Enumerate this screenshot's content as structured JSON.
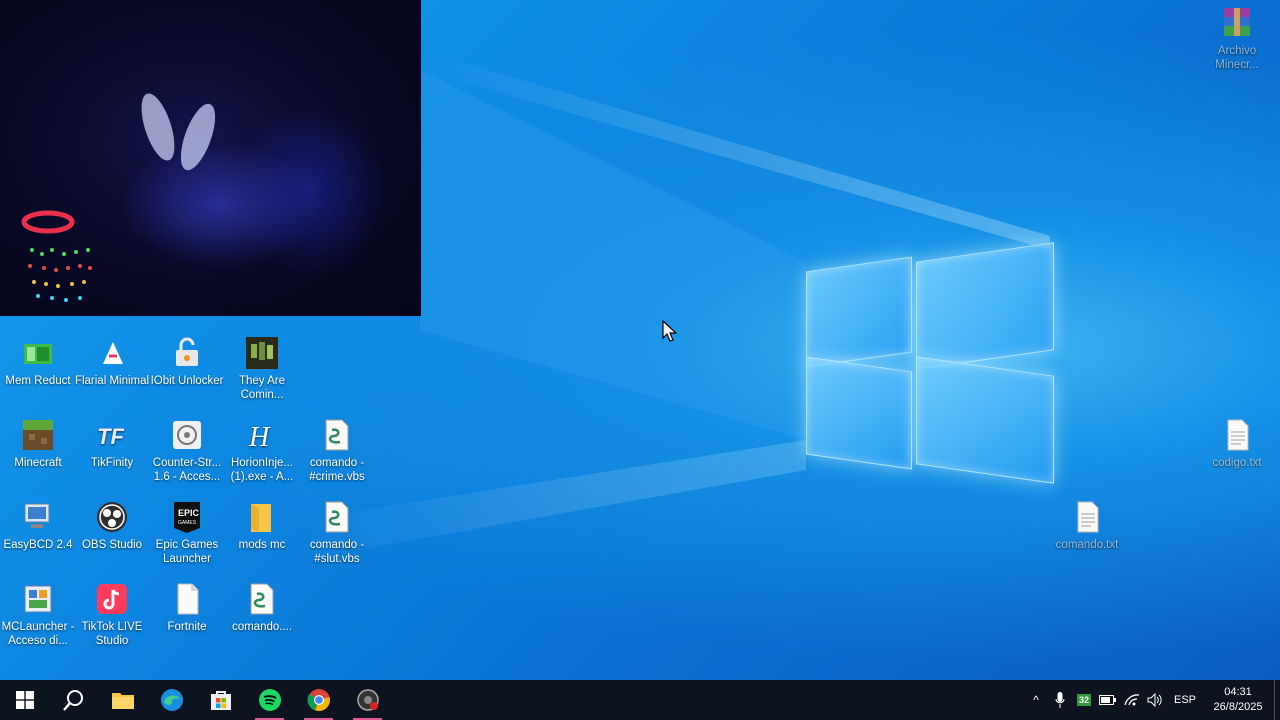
{
  "desktop": {
    "icons_left": [
      {
        "label": "Mem Reduct",
        "icon": "mem-reduct-icon"
      },
      {
        "label": "Flarial Minimal",
        "icon": "flarial-icon"
      },
      {
        "label": "IObit Unlocker",
        "icon": "iobit-unlocker-icon"
      },
      {
        "label": "They Are Comin...",
        "icon": "they-are-coming-icon"
      },
      {
        "label": "Minecraft",
        "icon": "minecraft-icon"
      },
      {
        "label": "TikFinity",
        "icon": "tikfinity-icon"
      },
      {
        "label": "Counter-Str... 1.6 - Acces...",
        "icon": "counter-strike-icon"
      },
      {
        "label": "HorionInje... (1).exe - A...",
        "icon": "horion-icon"
      },
      {
        "label": "comando - #crime.vbs",
        "icon": "vbs-script-icon"
      },
      {
        "label": "EasyBCD 2.4",
        "icon": "easybcd-icon"
      },
      {
        "label": "OBS Studio",
        "icon": "obs-icon"
      },
      {
        "label": "Epic Games Launcher",
        "icon": "epic-games-icon"
      },
      {
        "label": "mods mc",
        "icon": "folder-icon"
      },
      {
        "label": "comando - #slut.vbs",
        "icon": "vbs-script-icon"
      },
      {
        "label": "MCLauncher - Acceso di...",
        "icon": "mclauncher-icon"
      },
      {
        "label": "TikTok LIVE Studio",
        "icon": "tiktok-live-icon"
      },
      {
        "label": "Fortnite",
        "icon": "file-icon"
      },
      {
        "label": "comando....",
        "icon": "vbs-script-icon"
      }
    ],
    "icons_right": [
      {
        "label": "Archivo Minecr...",
        "icon": "winrar-icon"
      },
      {
        "label": "codigo.txt",
        "icon": "text-file-icon"
      },
      {
        "label": "comando.txt",
        "icon": "text-file-icon"
      }
    ]
  },
  "taskbar": {
    "apps": [
      "start-icon",
      "search-icon",
      "file-explorer-icon",
      "edge-icon",
      "store-icon",
      "spotify-icon",
      "chrome-icon",
      "obs-record-icon"
    ],
    "tray": {
      "chevron": "^",
      "badge": "32",
      "language": "ESP",
      "time": "04:31",
      "date": "26/8/2025"
    }
  },
  "colors": {
    "desktop_blue": "#0c86e0",
    "taskbar": "#0d1420",
    "active_indicator": "#e0598f"
  }
}
